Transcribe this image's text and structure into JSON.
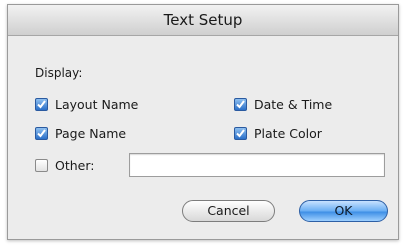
{
  "dialog": {
    "title": "Text Setup",
    "section_label": "Display:",
    "options": [
      {
        "label": "Layout Name",
        "checked": true
      },
      {
        "label": "Date & Time",
        "checked": true
      },
      {
        "label": "Page Name",
        "checked": true
      },
      {
        "label": "Plate Color",
        "checked": true
      },
      {
        "label": "Other:",
        "checked": false
      }
    ],
    "other_value": "",
    "buttons": {
      "cancel": "Cancel",
      "ok": "OK"
    }
  },
  "colors": {
    "checkbox_checked": "#2a6fc9",
    "default_button": "#3e8fe6",
    "dialog_background": "#ececec"
  }
}
